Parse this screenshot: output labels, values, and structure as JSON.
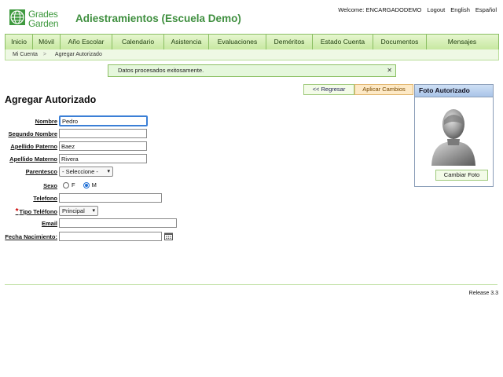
{
  "logo": {
    "line1": "Grades",
    "line2": "Garden"
  },
  "app_title": "Adiestramientos (Escuela Demo)",
  "top_links": {
    "welcome": "Welcome: ENCARGADODEMO",
    "logout": "Logout",
    "english": "English",
    "spanish": "Español"
  },
  "nav": [
    "Inicio",
    "Móvil",
    "Año Escolar",
    "Calendario",
    "Asistencia",
    "Evaluaciones",
    "Deméritos",
    "Estado Cuenta",
    "Documentos",
    "Mensajes"
  ],
  "breadcrumb": {
    "root": "Mi Cuenta",
    "sep": ">",
    "current": "Agregar Autorizado"
  },
  "success_message": "Datos procesados exitosamente.",
  "success_close": "✕",
  "buttons": {
    "back": "<< Regresar",
    "apply": "Aplicar Cambios",
    "change_photo": "Cambiar Foto"
  },
  "page_title": "Agregar Autorizado",
  "form": {
    "nombre": {
      "label": "Nombre",
      "value": "Pedro"
    },
    "segundo_nombre": {
      "label": "Segundo Nombre",
      "value": ""
    },
    "apellido_paterno": {
      "label": "Apellido Paterno",
      "value": "Baez"
    },
    "apellido_materno": {
      "label": "Apellido Materno",
      "value": "Rivera"
    },
    "parentesco": {
      "label": "Parentesco",
      "value": "- Seleccione -"
    },
    "sexo": {
      "label": "Sexo",
      "opt_f": "F",
      "opt_m": "M",
      "selected": "M"
    },
    "telefono": {
      "label": "Telefono",
      "value": ""
    },
    "tipo_telefono": {
      "label": "Tipo Teléfono",
      "required_mark": "*",
      "value": "Principal"
    },
    "email": {
      "label": "Email",
      "value": ""
    },
    "fecha_nacimiento": {
      "label": "Fecha Nacimiento:",
      "value": ""
    }
  },
  "photo_panel": {
    "title": "Foto Autorizado"
  },
  "release": "Release 3.3",
  "icons": {
    "calendar": "calendar-icon",
    "avatar": "avatar-placeholder",
    "logo": "globe-logo-icon"
  },
  "colors": {
    "accent_green": "#3f8f3f",
    "nav_bg": "#c7e8a0",
    "photo_head": "#a9c4e8",
    "required": "#cc0000"
  }
}
